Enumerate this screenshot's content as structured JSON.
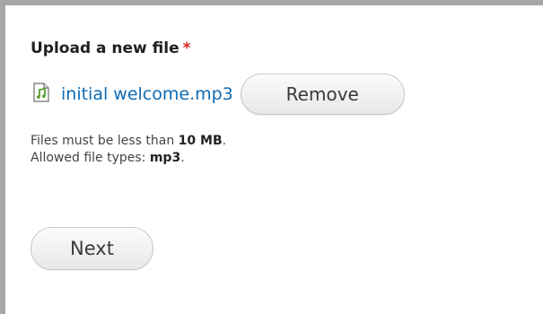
{
  "form": {
    "field_label": "Upload a new file",
    "required_marker": "*",
    "file": {
      "name": "initial welcome.mp3",
      "icon": "audio-file-icon",
      "icon_color": "#5a9e2f"
    },
    "remove_label": "Remove",
    "help": {
      "size_prefix": "Files must be less than ",
      "size_value": "10 MB",
      "size_suffix": ".",
      "types_prefix": "Allowed file types: ",
      "types_value": "mp3",
      "types_suffix": "."
    },
    "next_label": "Next"
  },
  "colors": {
    "link": "#0f6bb3",
    "required": "#e0281f",
    "frame_border": "#a6a6a6"
  }
}
